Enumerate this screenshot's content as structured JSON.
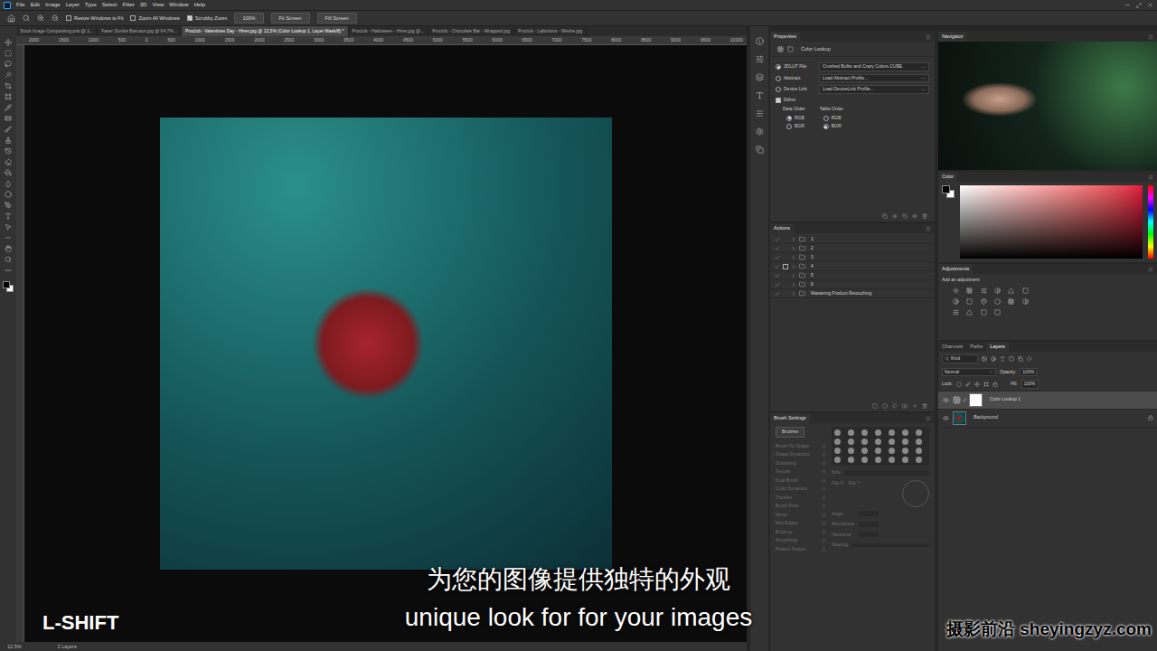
{
  "menu": [
    "File",
    "Edit",
    "Image",
    "Layer",
    "Type",
    "Select",
    "Filter",
    "3D",
    "View",
    "Window",
    "Help"
  ],
  "options": {
    "checkboxes": [
      {
        "label": "Resize Windows to Fit",
        "checked": false
      },
      {
        "label": "Zoom All Windows",
        "checked": false
      },
      {
        "label": "Scrubby Zoom",
        "checked": true
      }
    ],
    "buttons": [
      "100%",
      "Fit Screen",
      "Fill Screen"
    ]
  },
  "tabs": [
    {
      "label": "Stock Image Compositing.psb @ 2...",
      "selected": false
    },
    {
      "label": "Faser Dunkle Barcaus.jpg @ 64,7%...",
      "selected": false
    },
    {
      "label": "Proclub - Valentines Day - Hires.jpg @ 12,5% (Color Lookup 1, Layer Mask/8) *",
      "selected": true
    },
    {
      "label": "Proclub - Halloween - Hires.jpg @...",
      "selected": false
    },
    {
      "label": "Proclub - Chocolate Bar - Wrapped.jpg",
      "selected": false
    },
    {
      "label": "Proclub - Labrotons - Meshe.jpg",
      "selected": false
    }
  ],
  "ruler": [
    "2000",
    "1500",
    "1000",
    "500",
    "0",
    "500",
    "1000",
    "1500",
    "2000",
    "2500",
    "3000",
    "3500",
    "4000",
    "4500",
    "5000",
    "5500",
    "6000",
    "6500",
    "7000",
    "7500",
    "8000",
    "8500",
    "9000",
    "9500",
    "10000"
  ],
  "status": {
    "zoom": "12.5%",
    "info": "2 Layers"
  },
  "properties": {
    "title": "Properties",
    "subtitle": "Color Lookup",
    "sources": [
      {
        "label": "3DLUT File",
        "value": "Crushed Bulbs and Crazy Colors.CUBE",
        "selected": true
      },
      {
        "label": "Abstract",
        "value": "Load Abstract Profile...",
        "selected": false
      },
      {
        "label": "Device Link",
        "value": "Load DeviceLink Profile...",
        "selected": false
      }
    ],
    "dither": {
      "label": "Dither",
      "checked": true
    },
    "data_order": {
      "label": "Data Order",
      "options": [
        {
          "label": "RGB",
          "selected": true
        },
        {
          "label": "BGR",
          "selected": false
        }
      ]
    },
    "table_order": {
      "label": "Table Order",
      "options": [
        {
          "label": "RGB",
          "selected": false
        },
        {
          "label": "BGR",
          "selected": true
        }
      ]
    }
  },
  "actions": {
    "title": "Actions",
    "items": [
      {
        "label": "1",
        "checked": true,
        "dialog": false
      },
      {
        "label": "2",
        "checked": true,
        "dialog": false
      },
      {
        "label": "3",
        "checked": true,
        "dialog": false
      },
      {
        "label": "4",
        "checked": true,
        "dialog": true
      },
      {
        "label": "5",
        "checked": true,
        "dialog": false
      },
      {
        "label": "6",
        "checked": true,
        "dialog": false
      },
      {
        "label": "Mastering Product Retouching",
        "checked": true,
        "dialog": false
      }
    ]
  },
  "brush_settings": {
    "title": "Brush Settings",
    "button": "Brushes",
    "items": [
      {
        "label": "Brush Tip Shape",
        "disabled": true
      },
      {
        "label": "Shape Dynamics",
        "disabled": true
      },
      {
        "label": "Scattering",
        "disabled": true
      },
      {
        "label": "Texture",
        "disabled": true
      },
      {
        "label": "Dual Brush",
        "disabled": true
      },
      {
        "label": "Color Dynamics",
        "disabled": true
      },
      {
        "label": "Transfer",
        "disabled": true
      },
      {
        "label": "Brush Pose",
        "disabled": true
      },
      {
        "label": "Noise",
        "disabled": true
      },
      {
        "label": "Wet Edges",
        "disabled": true
      },
      {
        "label": "Build-up",
        "disabled": true
      },
      {
        "label": "Smoothing",
        "disabled": true
      },
      {
        "label": "Protect Texture",
        "disabled": true
      }
    ],
    "size_label": "Size",
    "flip": [
      "Flip X",
      "Flip Y"
    ],
    "fields": [
      "Angle",
      "Roundness",
      "Hardness"
    ],
    "spacing_label": "Spacing"
  },
  "navigator": {
    "title": "Navigator"
  },
  "color": {
    "title": "Color"
  },
  "adjustments": {
    "title": "Adjustments",
    "hint": "Add an adjustment"
  },
  "layers": {
    "tabs": [
      {
        "label": "Channels",
        "selected": false
      },
      {
        "label": "Paths",
        "selected": false
      },
      {
        "label": "Layers",
        "selected": true
      }
    ],
    "filter": "Kind",
    "blend": "Normal",
    "opacity_label": "Opacity:",
    "opacity": "100%",
    "lock_label": "Lock:",
    "fill_label": "Fill:",
    "fill": "100%",
    "items": [
      {
        "name": "Color Lookup 1",
        "selected": true,
        "visible": true,
        "locked": false,
        "kind": "adjustment"
      },
      {
        "name": "Background",
        "selected": false,
        "visible": true,
        "locked": true,
        "kind": "image"
      }
    ]
  },
  "subtitles": {
    "zh": "为您的图像提供独特的外观",
    "en": "unique look for for your images"
  },
  "hotkey": "L-SHIFT",
  "watermark": "摄影前沿 sheyingzyz.com"
}
